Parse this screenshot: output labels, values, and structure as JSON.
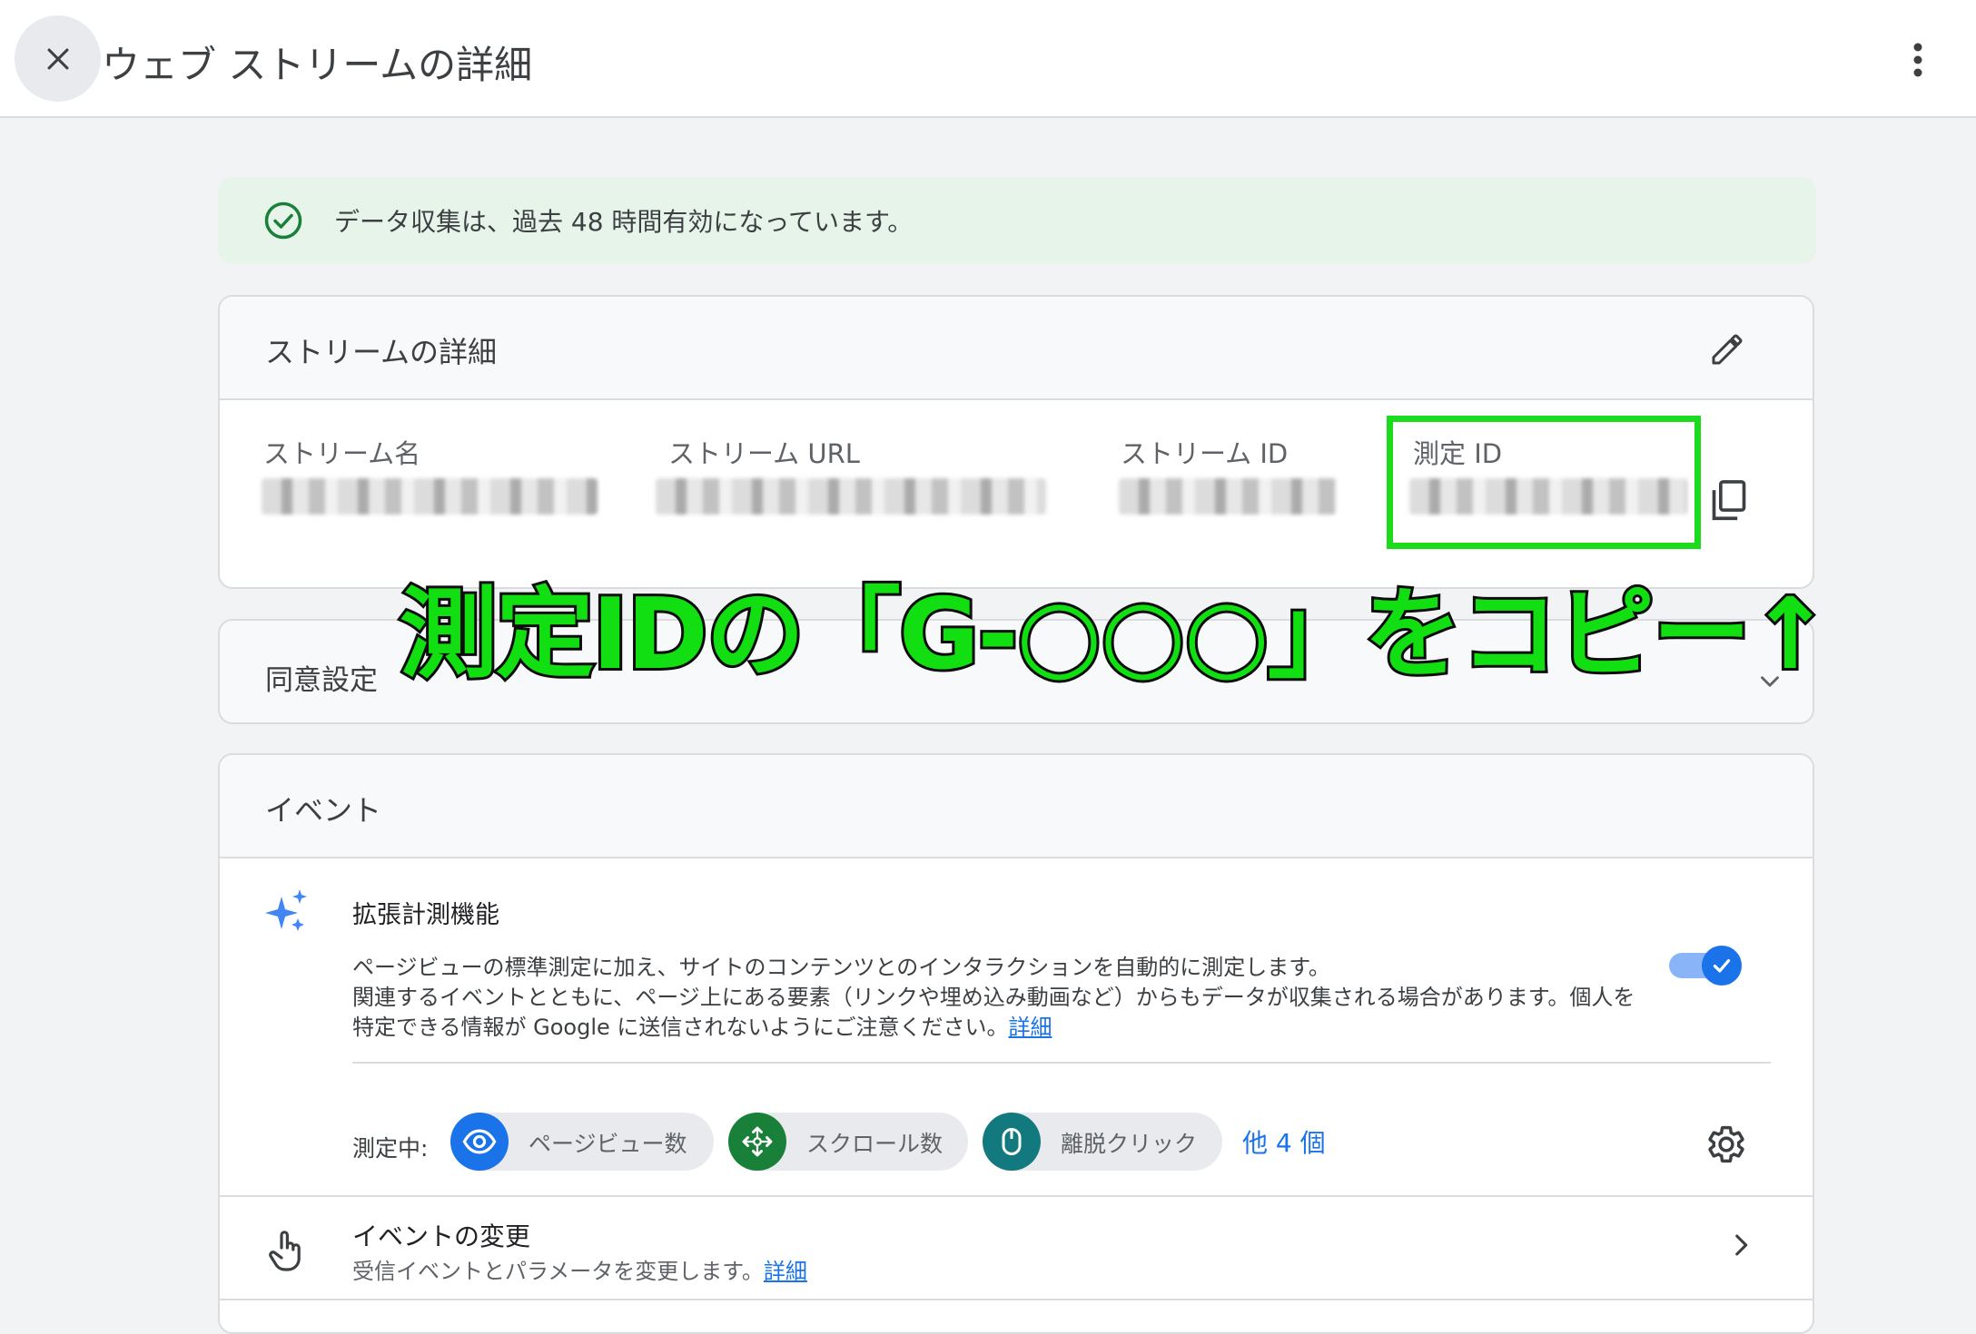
{
  "header": {
    "title": "ウェブ ストリームの詳細",
    "close_icon": "close-icon",
    "more_icon": "more-vert-icon"
  },
  "banner": {
    "text": "データ収集は、過去 48 時間有効になっています。",
    "icon": "check-circle-icon",
    "color": "#e6f4ea"
  },
  "stream_details": {
    "title": "ストリームの詳細",
    "edit_icon": "pencil-icon",
    "fields": {
      "name_label": "ストリーム名",
      "url_label": "ストリーム URL",
      "id_label": "ストリーム ID",
      "measurement_id_label": "測定 ID"
    },
    "copy_icon": "copy-icon"
  },
  "annotation": {
    "text": "測定IDの「G-○○○」をコピー↑",
    "color": "#11df11"
  },
  "consent": {
    "title": "同意設定",
    "expand_icon": "chevron-down-icon"
  },
  "events": {
    "title": "イベント",
    "enhanced": {
      "title": "拡張計測機能",
      "desc_line1": "ページビューの標準測定に加え、サイトのコンテンツとのインタラクションを自動的に測定します。",
      "desc_line2": "関連するイベントとともに、ページ上にある要素（リンクや埋め込み動画など）からもデータが収集される場合があります。個人を",
      "desc_line3": "特定できる情報が Google に送信されないようにご注意ください。",
      "detail_link": "詳細",
      "toggle_on": true,
      "measuring_label": "測定中:",
      "chips": [
        {
          "label": "ページビュー数",
          "icon": "eye-icon",
          "color": "#1a73e8"
        },
        {
          "label": "スクロール数",
          "icon": "scroll-arrows-icon",
          "color": "#188038"
        },
        {
          "label": "離脱クリック",
          "icon": "mouse-icon",
          "color": "#12797f"
        }
      ],
      "more_link": "他 4 個",
      "settings_icon": "gear-icon"
    },
    "modify": {
      "title": "イベントの変更",
      "subtitle": "受信イベントとパラメータを変更します。",
      "detail_link": "詳細",
      "chevron_icon": "chevron-right-icon"
    }
  }
}
